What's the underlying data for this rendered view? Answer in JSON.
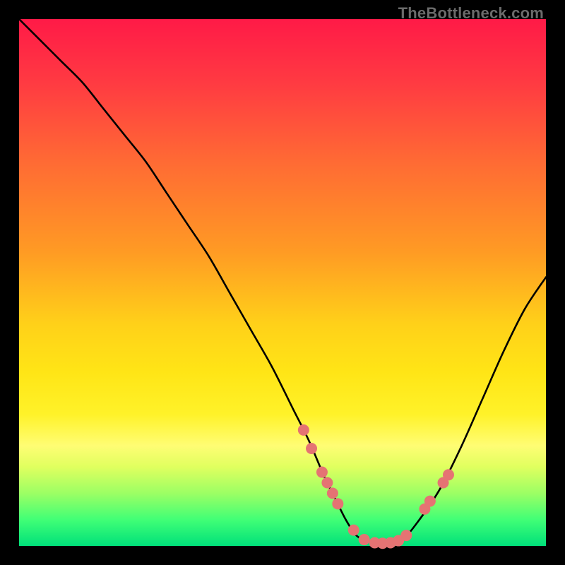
{
  "attribution": "TheBottleneck.com",
  "chart_data": {
    "type": "line",
    "title": "",
    "xlabel": "",
    "ylabel": "",
    "xlim": [
      0,
      100
    ],
    "ylim": [
      0,
      100
    ],
    "series": [
      {
        "name": "bottleneck-curve",
        "x": [
          0,
          4,
          8,
          12,
          16,
          20,
          24,
          28,
          32,
          36,
          40,
          44,
          48,
          52,
          55,
          58,
          60,
          62,
          64,
          66,
          68,
          70,
          73,
          76,
          80,
          84,
          88,
          92,
          96,
          100
        ],
        "y": [
          100,
          96,
          92,
          88,
          83,
          78,
          73,
          67,
          61,
          55,
          48,
          41,
          34,
          26,
          20,
          13,
          9,
          5,
          2,
          1,
          0.5,
          0.5,
          1.5,
          5,
          11,
          19,
          28,
          37,
          45,
          51
        ]
      }
    ],
    "markers": {
      "name": "highlight-points",
      "color": "#e57373",
      "radius": 8,
      "points": [
        {
          "x": 54.0,
          "y": 22.0
        },
        {
          "x": 55.5,
          "y": 18.5
        },
        {
          "x": 57.5,
          "y": 14.0
        },
        {
          "x": 58.5,
          "y": 12.0
        },
        {
          "x": 59.5,
          "y": 10.0
        },
        {
          "x": 60.5,
          "y": 8.0
        },
        {
          "x": 63.5,
          "y": 3.0
        },
        {
          "x": 65.5,
          "y": 1.2
        },
        {
          "x": 67.5,
          "y": 0.6
        },
        {
          "x": 69.0,
          "y": 0.5
        },
        {
          "x": 70.5,
          "y": 0.6
        },
        {
          "x": 72.0,
          "y": 1.0
        },
        {
          "x": 73.5,
          "y": 2.0
        },
        {
          "x": 77.0,
          "y": 7.0
        },
        {
          "x": 78.0,
          "y": 8.5
        },
        {
          "x": 80.5,
          "y": 12.0
        },
        {
          "x": 81.5,
          "y": 13.5
        }
      ]
    }
  }
}
